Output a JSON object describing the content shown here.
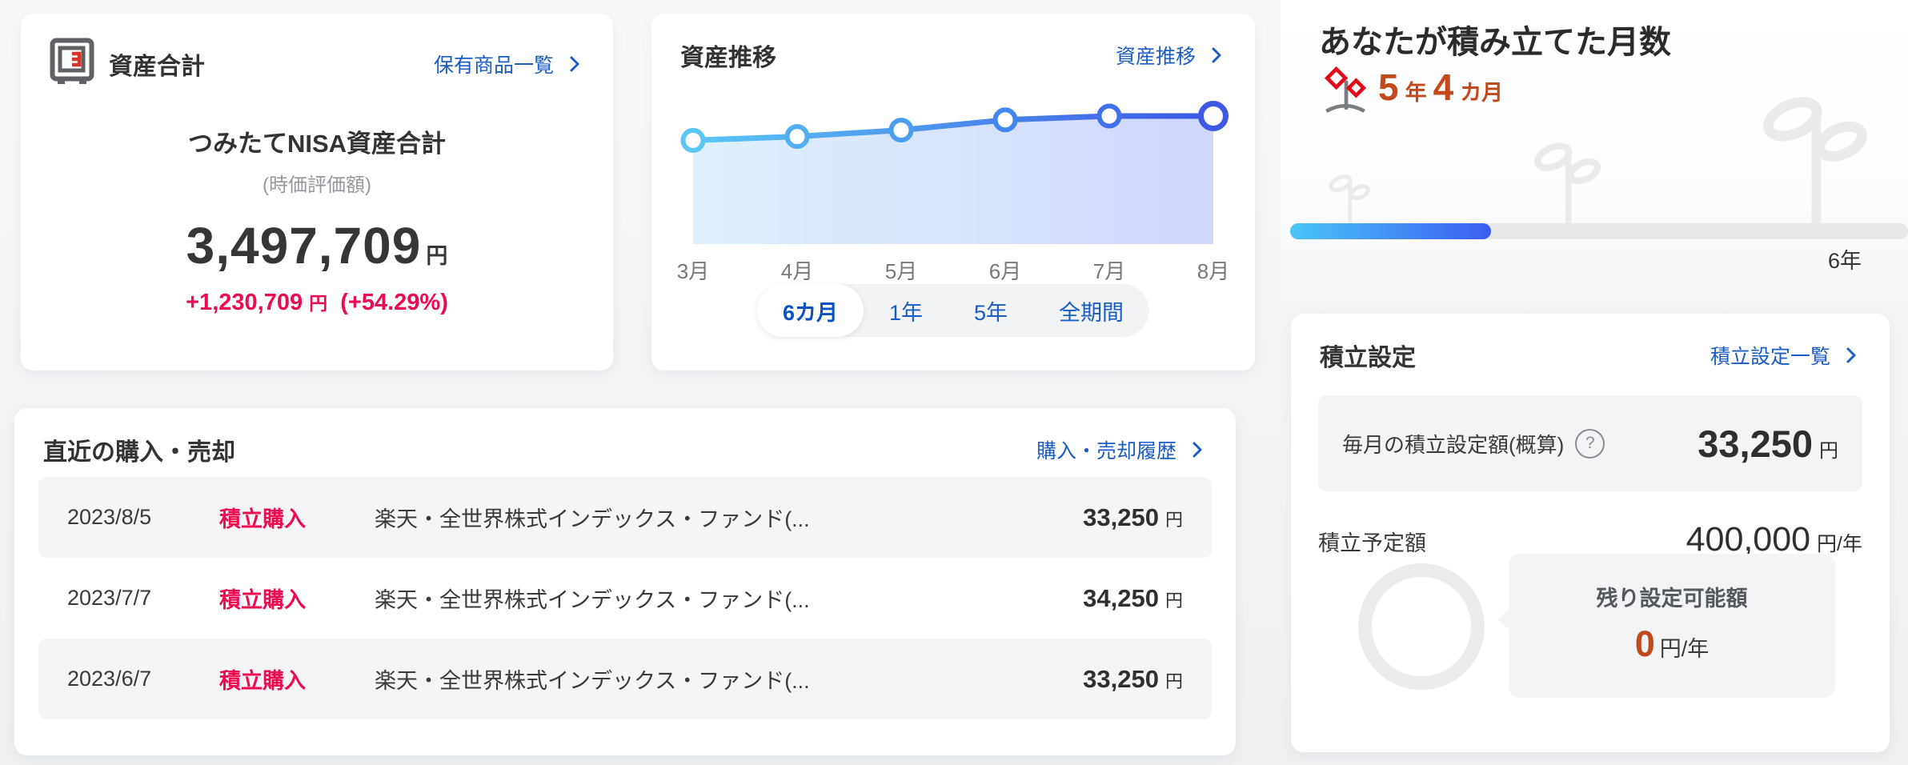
{
  "colors": {
    "link_blue": "#1a5cc5",
    "tab_active_blue": "#0b51c1",
    "crimson": "#ec0a50",
    "vermillion": "#c2491b",
    "progress_gradient": [
      "#4ac6f7",
      "#3a5cf0"
    ],
    "page_background": "#f2f3f5"
  },
  "assets_card": {
    "title": "資産合計",
    "link_label": "保有商品一覧",
    "subtitle": "つみたてNISA資産合計",
    "subtitle_note": "(時価評価額)",
    "total_value": "3,497,709",
    "total_unit": "円",
    "gain_value": "+1,230,709",
    "gain_unit": "円",
    "gain_pct": "(+54.29%)"
  },
  "chart_card": {
    "title": "資産推移",
    "link_label": "資産推移",
    "tabs": [
      "6カ月",
      "1年",
      "5年",
      "全期間"
    ],
    "active_tab": "6カ月"
  },
  "chart_data": {
    "type": "area",
    "title": "資産推移",
    "x_labels": [
      "3月",
      "4月",
      "5月",
      "6月",
      "7月",
      "8月"
    ],
    "values_norm": [
      0.81,
      0.84,
      0.89,
      0.97,
      1.0,
      1.0
    ],
    "y_axis": "unlabeled (no ticks or gridlines shown)",
    "grid": false,
    "legend": false,
    "line_gradient": [
      "#5bc6f4",
      "#3c56e4"
    ],
    "area_gradient": [
      "#dbeffc",
      "#c9d1f8"
    ],
    "point_colors": [
      "#5BC6F3",
      "#51AFF1",
      "#4A9EF0",
      "#4386EE",
      "#4170ED",
      "#4059E4"
    ]
  },
  "months_panel": {
    "title": "あなたが積み立てた月数",
    "years_value": "5",
    "years_unit": "年",
    "months_value": "4",
    "months_unit": "カ月",
    "progress_pct": 32.5,
    "goal_label": "6年"
  },
  "settings_card": {
    "title": "積立設定",
    "link_label": "積立設定一覧",
    "monthly_label": "毎月の積立設定額(概算)",
    "help_glyph": "?",
    "monthly_value": "33,250",
    "monthly_unit": "円",
    "planned_label": "積立予定額",
    "planned_value": "400,000",
    "planned_unit": "円/年",
    "remaining_label": "残り設定可能額",
    "remaining_value": "0",
    "remaining_unit": "円/年"
  },
  "history_card": {
    "title": "直近の購入・売却",
    "link_label": "購入・売却履歴",
    "rows": [
      {
        "date": "2023/8/5",
        "type": "積立購入",
        "fund": "楽天・全世界株式インデックス・ファンド(...",
        "amount": "33,250",
        "unit": "円"
      },
      {
        "date": "2023/7/7",
        "type": "積立購入",
        "fund": "楽天・全世界株式インデックス・ファンド(...",
        "amount": "34,250",
        "unit": "円"
      },
      {
        "date": "2023/6/7",
        "type": "積立購入",
        "fund": "楽天・全世界株式インデックス・ファンド(...",
        "amount": "33,250",
        "unit": "円"
      }
    ]
  }
}
